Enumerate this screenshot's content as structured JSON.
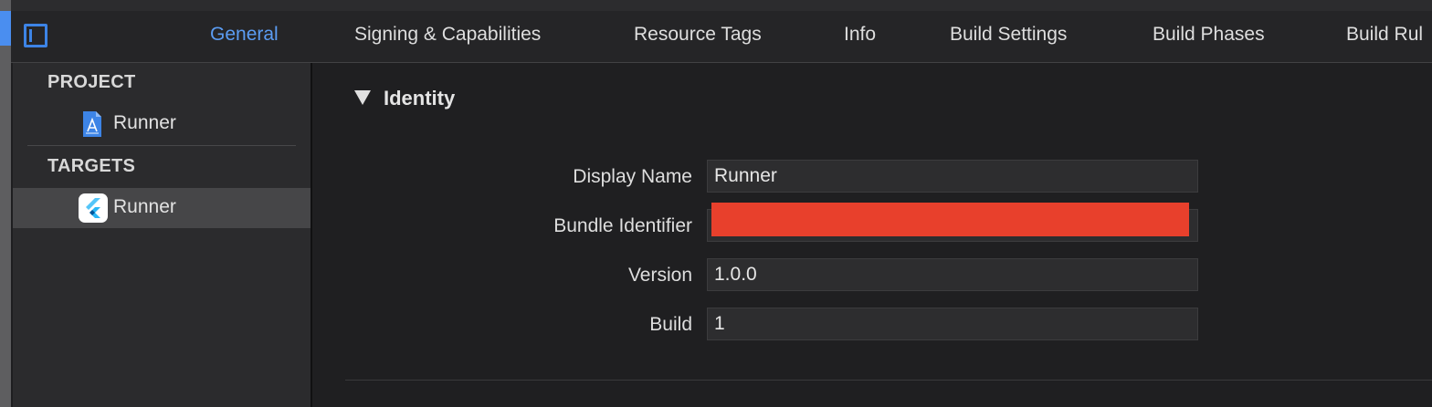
{
  "tabs": [
    {
      "label": "General",
      "active": true
    },
    {
      "label": "Signing & Capabilities",
      "active": false
    },
    {
      "label": "Resource Tags",
      "active": false
    },
    {
      "label": "Info",
      "active": false
    },
    {
      "label": "Build Settings",
      "active": false
    },
    {
      "label": "Build Phases",
      "active": false
    },
    {
      "label": "Build Rul",
      "active": false
    }
  ],
  "sidebar": {
    "project_header": "PROJECT",
    "project_item": {
      "label": "Runner",
      "icon": "xcodeproj-file-icon"
    },
    "targets_header": "TARGETS",
    "target_item": {
      "label": "Runner",
      "icon": "flutter-app-icon",
      "selected": true
    }
  },
  "identity": {
    "title": "Identity",
    "fields": {
      "display_name": {
        "label": "Display Name",
        "value": "Runner"
      },
      "bundle_identifier": {
        "label": "Bundle Identifier",
        "value": ""
      },
      "version": {
        "label": "Version",
        "value": "1.0.0"
      },
      "build": {
        "label": "Build",
        "value": "1"
      }
    }
  },
  "colors": {
    "accent": "#3d84e6",
    "active_tab": "#5b9cf2",
    "redaction": "#e8402c",
    "selection": "#464648"
  }
}
